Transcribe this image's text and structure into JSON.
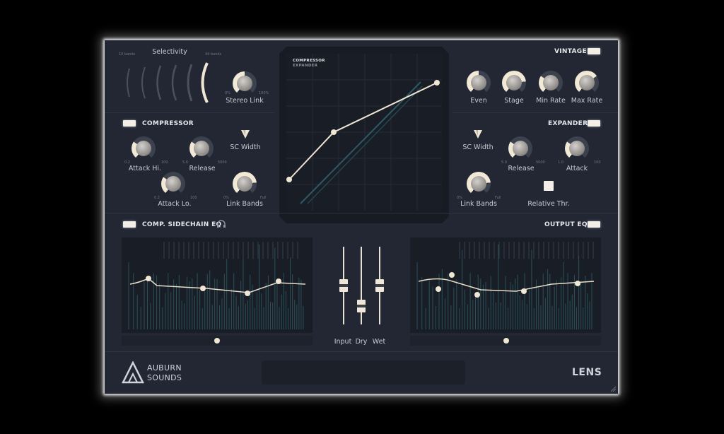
{
  "selectivity": {
    "title": "Selectivity",
    "left_label": "10 bands",
    "right_label": "44 bands"
  },
  "stereo_link": {
    "label": "Stereo Link",
    "min": "0%",
    "max": "100%",
    "value_fraction": 0.5
  },
  "vintage": {
    "label": "VINTAGE",
    "knobs": [
      {
        "label": "Even",
        "value_fraction": 0.5
      },
      {
        "label": "Stage",
        "value_fraction": 0.8
      },
      {
        "label": "Min Rate",
        "value_fraction": 0.3
      },
      {
        "label": "Max Rate",
        "value_fraction": 0.7
      }
    ]
  },
  "compressor": {
    "label": "COMPRESSOR",
    "attack_hi": {
      "label": "Attack Hi.",
      "min": "0.2",
      "max": "100",
      "value_fraction": 0.3
    },
    "release": {
      "label": "Release",
      "min": "5.0",
      "max": "5000",
      "value_fraction": 0.3
    },
    "sc_width": {
      "label": "SC Width"
    },
    "attack_lo": {
      "label": "Attack Lo.",
      "min": "0.2",
      "max": "100",
      "value_fraction": 0.3
    },
    "link_bands": {
      "label": "Link Bands",
      "min": "0%",
      "max": "Full",
      "value_fraction": 0.8
    }
  },
  "expander": {
    "label": "EXPANDER",
    "sc_width": {
      "label": "SC Width"
    },
    "release": {
      "label": "Release",
      "min": "5.0",
      "max": "5000",
      "value_fraction": 0.3
    },
    "attack": {
      "label": "Attack",
      "min": "1.0",
      "max": "100",
      "value_fraction": 0.3
    },
    "link_bands": {
      "label": "Link Bands",
      "min": "0%",
      "max": "Full",
      "value_fraction": 0.8
    },
    "relative_thr": {
      "label": "Relative Thr."
    }
  },
  "graph": {
    "compressor_label": "COMPRESSOR",
    "expander_label": "EXPANDER"
  },
  "sidechain_eq": {
    "label": "COMP. SIDECHAIN EQ"
  },
  "output_eq": {
    "label": "OUTPUT EQ"
  },
  "mix": {
    "input_label": "Input",
    "dry_label": "Dry",
    "wet_label": "Wet"
  },
  "brand": {
    "line1": "AUBURN",
    "line2": "SOUNDS",
    "product": "LENS"
  },
  "colors": {
    "accent": "#efe6d3",
    "panel": "#222733",
    "screen": "#191d26"
  }
}
